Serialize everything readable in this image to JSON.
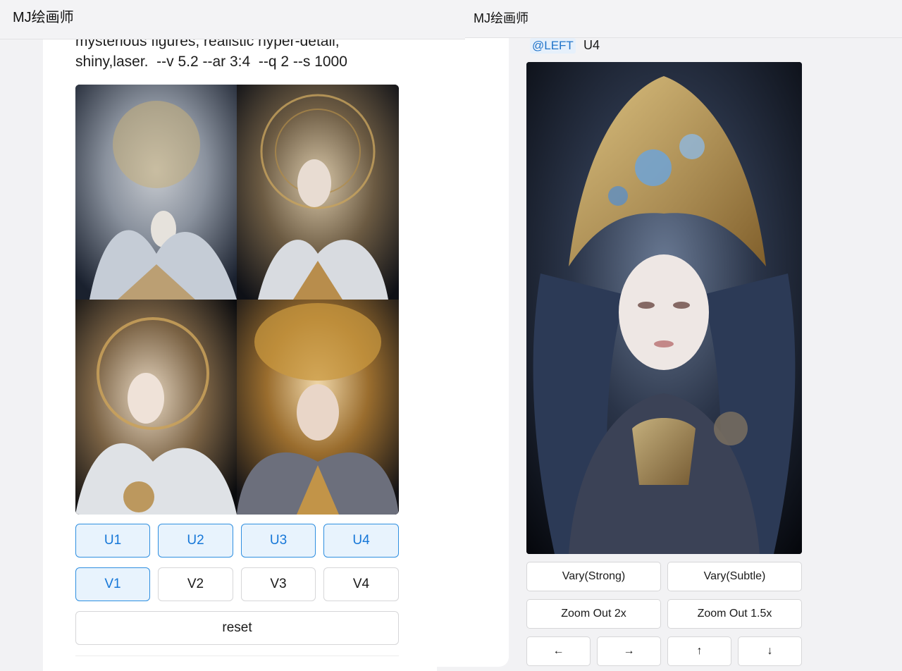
{
  "left": {
    "header_title": "MJ绘画师",
    "prompt_line1": "mysterious figures, realistic hyper-detail,",
    "prompt_line2": "shiny,laser.  --v 5.2 --ar 3:4  --q 2 --s 1000",
    "upscale_buttons": [
      "U1",
      "U2",
      "U3",
      "U4"
    ],
    "variation_buttons": [
      "V1",
      "V2",
      "V3",
      "V4"
    ],
    "reset_label": "reset"
  },
  "right": {
    "header_title": "MJ绘画师",
    "mention": "@LEFT",
    "mention_suffix": "U4",
    "vary_strong_label": "Vary(Strong)",
    "vary_subtle_label": "Vary(Subtle)",
    "zoom_out_2x_label": "Zoom Out 2x",
    "zoom_out_1_5x_label": "Zoom Out 1.5x",
    "pan_left_label": "←",
    "pan_right_label": "→",
    "pan_up_label": "↑",
    "pan_down_label": "↓"
  },
  "colors": {
    "accent": "#1677d8",
    "accent_bg": "#e8f3fd",
    "header_bg": "#f3f3f5",
    "mention_bg": "#e6f0fb"
  },
  "icons": {
    "pan_left": "arrow-left-icon",
    "pan_right": "arrow-right-icon",
    "pan_up": "arrow-up-icon",
    "pan_down": "arrow-down-icon"
  }
}
